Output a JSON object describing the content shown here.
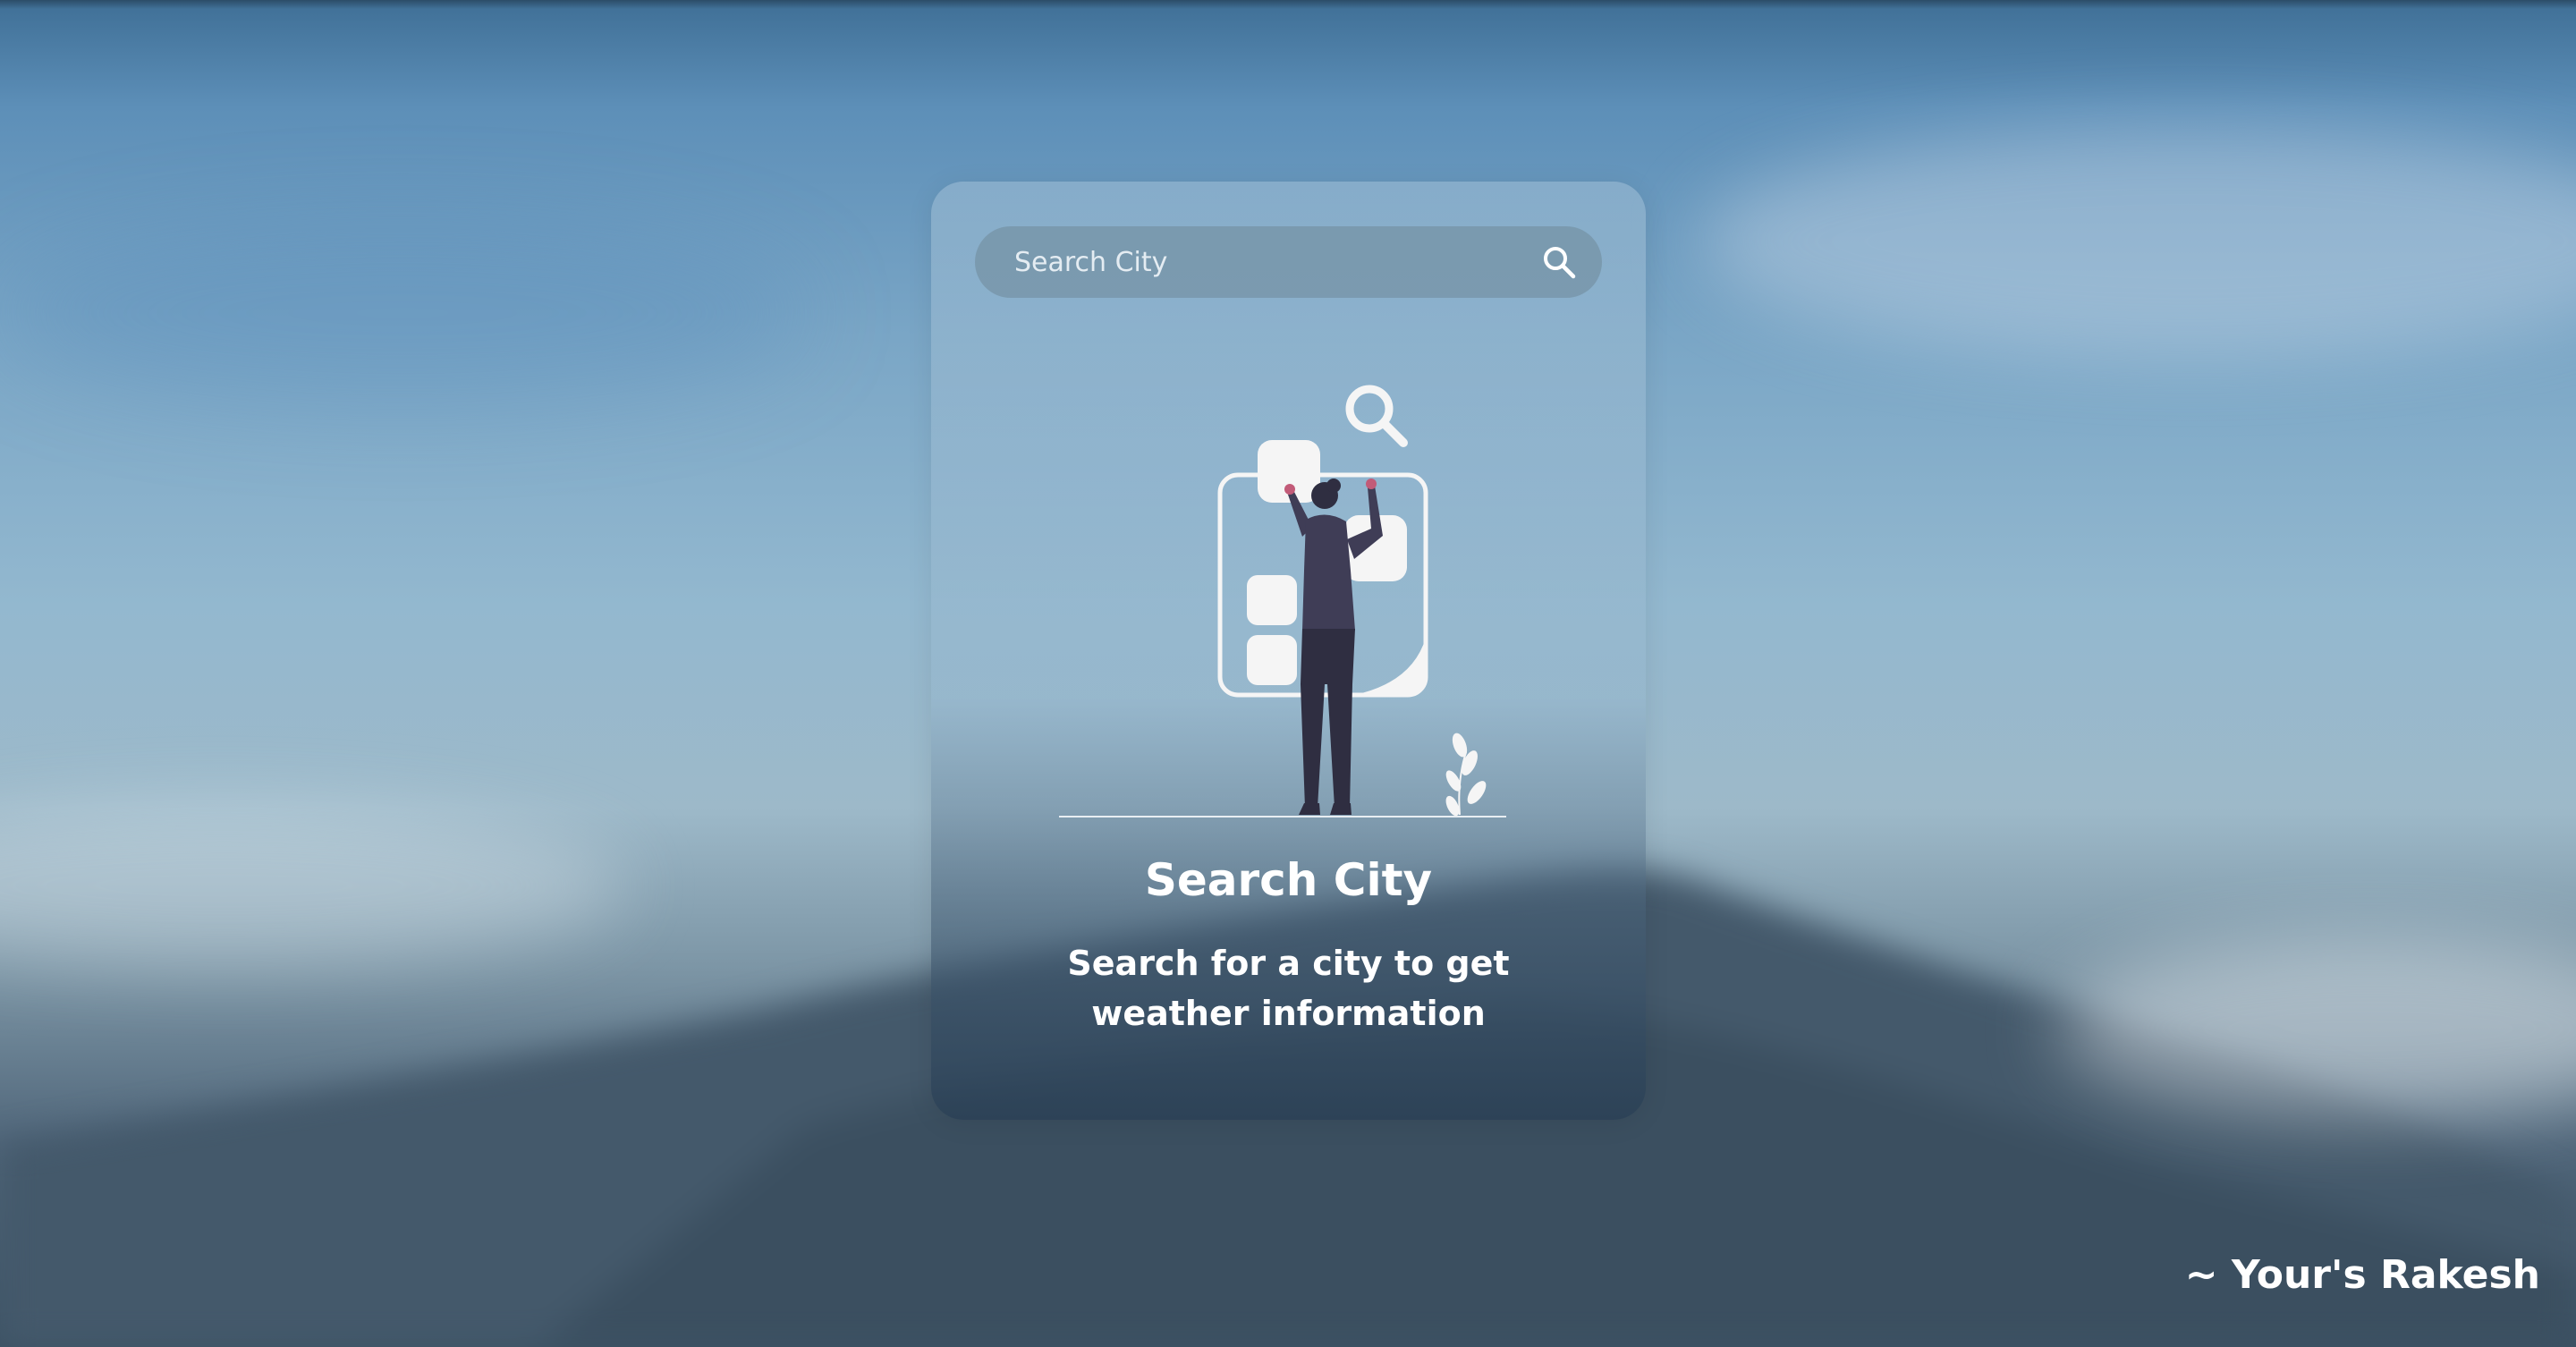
{
  "search": {
    "placeholder": "Search City",
    "icon": "search-icon"
  },
  "empty_state": {
    "illustration": "person-searching-illustration",
    "title": "Search City",
    "description": "Search for a city to get weather information"
  },
  "signature": "~ Your's Rakesh",
  "colors": {
    "card_overlay": "#9bbbd4",
    "search_bar": "#7896aa",
    "text": "#ffffff",
    "figure": "#3f3d56",
    "figure_legs": "#2f2e41",
    "accent": "#c25b78"
  }
}
